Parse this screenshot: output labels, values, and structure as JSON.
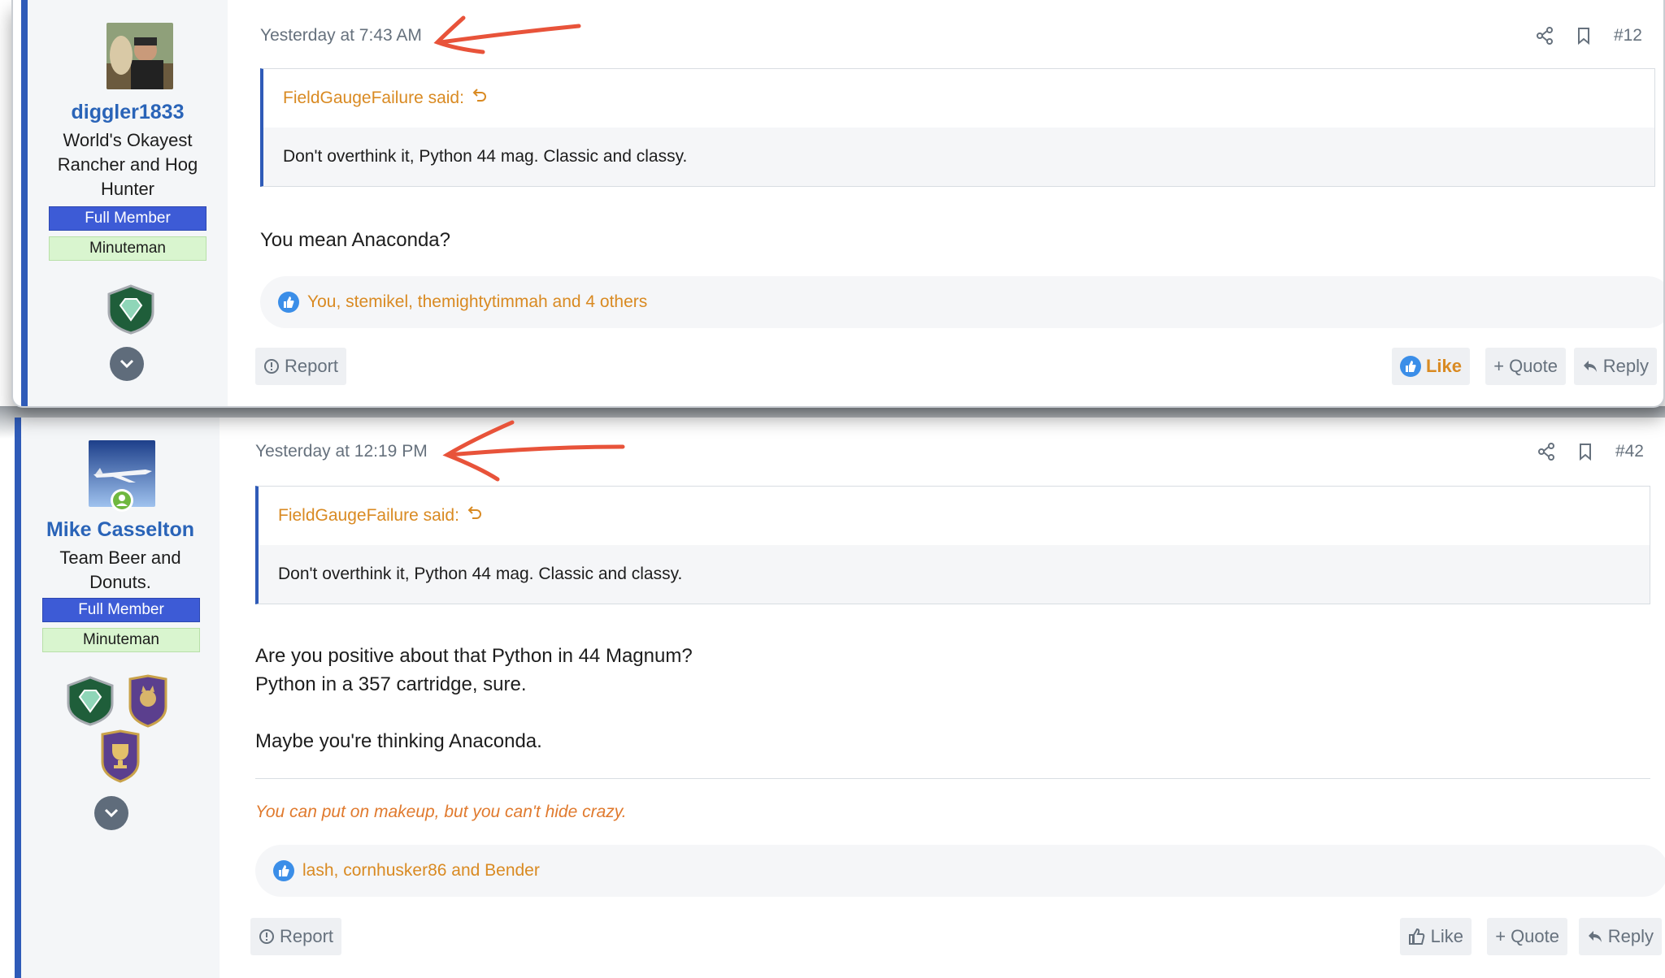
{
  "posts": [
    {
      "username": "diggler1833",
      "user_title": [
        "World's Okayest",
        "Rancher and Hog",
        "Hunter"
      ],
      "banners": [
        "Full Member",
        "Minuteman"
      ],
      "date": "Yesterday at 7:43 AM",
      "post_number": "#12",
      "quote_author": "FieldGaugeFailure said:",
      "quote_text": "Don't overthink it, Python 44 mag. Classic and classy.",
      "message": [
        "You mean Anaconda?"
      ],
      "likes": "You, stemikel, themightytimmah and 4 others",
      "actions": {
        "report": "Report",
        "like": "Like",
        "quote": "Quote",
        "reply": "Reply"
      }
    },
    {
      "username": "Mike Casselton",
      "user_title": [
        "Team Beer and",
        "Donuts."
      ],
      "banners": [
        "Full Member",
        "Minuteman"
      ],
      "date": "Yesterday at 12:19 PM",
      "post_number": "#42",
      "quote_author": "FieldGaugeFailure said:",
      "quote_text": "Don't overthink it, Python 44 mag. Classic and classy.",
      "message": [
        "Are you positive about that Python in 44 Magnum?",
        "Python in a 357 cartridge, sure.",
        "",
        "Maybe you're thinking Anaconda."
      ],
      "signature": "You can put on makeup, but you can't hide crazy.",
      "likes": "lash, cornhusker86 and Bender",
      "actions": {
        "report": "Report",
        "like": "Like",
        "quote": "Quote",
        "reply": "Reply"
      }
    }
  ],
  "icons": {
    "share": "share-icon",
    "bookmark": "bookmark-icon",
    "report": "report-icon",
    "like": "thumbs-up-icon",
    "quote": "plus-icon",
    "reply": "reply-arrow-icon",
    "expand": "chevron-down-icon"
  },
  "colors": {
    "accent": "#2f5bb8",
    "link": "#2a64b8",
    "orange": "#d98a22",
    "annotation": "#e8533a"
  }
}
